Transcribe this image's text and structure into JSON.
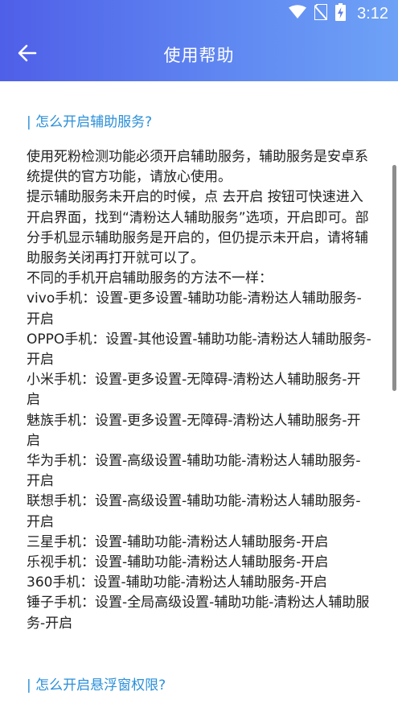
{
  "status_bar": {
    "time": "3:12",
    "icons": [
      "wifi-icon",
      "no-sim-icon",
      "battery-charging-icon"
    ]
  },
  "toolbar": {
    "back_icon": "arrow-left-icon",
    "title": "使用帮助"
  },
  "sections": [
    {
      "title": "| 怎么开启辅助服务?",
      "paragraphs": [
        "使用死粉检测功能必须开启辅助服务，辅助服务是安卓系统提供的官方功能，请放心使用。",
        "提示辅助服务未开启的时候，点 去开启 按钮可快速进入开启界面，找到“清粉达人辅助服务”选项，开启即可。部分手机显示辅助服务是开启的，但仍提示未开启，请将辅助服务关闭再打开就可以了。",
        "不同的手机开启辅助服务的方法不一样：",
        "vivo手机：设置-更多设置-辅助功能-清粉达人辅助服务-开启",
        "OPPO手机：设置-其他设置-辅助功能-清粉达人辅助服务-开启",
        "小米手机：设置-更多设置-无障碍-清粉达人辅助服务-开启",
        "魅族手机：设置-更多设置-无障碍-清粉达人辅助服务-开启",
        "华为手机：设置-高级设置-辅助功能-清粉达人辅助服务-开启",
        "联想手机：设置-高级设置-辅助功能-清粉达人辅助服务-开启",
        "三星手机：设置-辅助功能-清粉达人辅助服务-开启",
        "乐视手机：设置-辅助功能-清粉达人辅助服务-开启",
        "360手机：设置-辅助功能-清粉达人辅助服务-开启",
        "锤子手机：设置-全局高级设置-辅助功能-清粉达人辅助服务-开启"
      ]
    },
    {
      "title": "| 怎么开启悬浮窗权限?"
    }
  ],
  "colors": {
    "appbar_start": "#4f5fe8",
    "appbar_end": "#6ea2f6",
    "section_title": "#2a8fd9",
    "body_text": "#222222"
  }
}
